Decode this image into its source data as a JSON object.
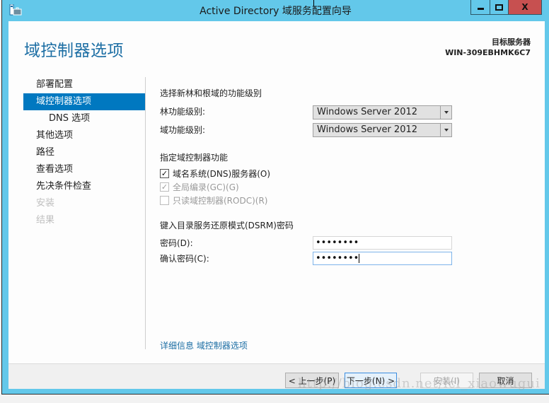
{
  "window": {
    "title": "Active Directory 域服务配置向导",
    "controls": {
      "minimize": "minimize",
      "maximize": "maximize",
      "close": "X"
    }
  },
  "header": {
    "page_title": "域控制器选项",
    "target_server_label": "目标服务器",
    "target_server_name": "WIN-309EBHMK6C7"
  },
  "sidebar": {
    "items": [
      {
        "label": "部署配置",
        "state": "normal"
      },
      {
        "label": "域控制器选项",
        "state": "active"
      },
      {
        "label": "DNS 选项",
        "state": "sub"
      },
      {
        "label": "其他选项",
        "state": "normal"
      },
      {
        "label": "路径",
        "state": "normal"
      },
      {
        "label": "查看选项",
        "state": "normal"
      },
      {
        "label": "先决条件检查",
        "state": "normal"
      },
      {
        "label": "安装",
        "state": "disabled"
      },
      {
        "label": "结果",
        "state": "disabled"
      }
    ]
  },
  "main": {
    "functional_level_heading": "选择新林和根域的功能级别",
    "forest_level_label": "林功能级别:",
    "forest_level_value": "Windows Server 2012",
    "domain_level_label": "域功能级别:",
    "domain_level_value": "Windows Server 2012",
    "dc_capabilities_heading": "指定域控制器功能",
    "capabilities": [
      {
        "label": "域名系统(DNS)服务器(O)",
        "checked": true,
        "enabled": true
      },
      {
        "label": "全局编录(GC)(G)",
        "checked": true,
        "enabled": false
      },
      {
        "label": "只读域控制器(RODC)(R)",
        "checked": false,
        "enabled": false
      }
    ],
    "dsrm_heading": "键入目录服务还原模式(DSRM)密码",
    "password_label": "密码(D):",
    "password_value": "••••••••",
    "confirm_password_label": "确认密码(C):",
    "confirm_password_value": "••••••••",
    "more_info_link": "详细信息 域控制器选项"
  },
  "footer": {
    "back_label": "< 上一步(P)",
    "next_label": "下一步(N) >",
    "install_label": "安装(I)",
    "cancel_label": "取消"
  },
  "watermark": "http://blog.csdn.net/lcl_xiaowugui"
}
